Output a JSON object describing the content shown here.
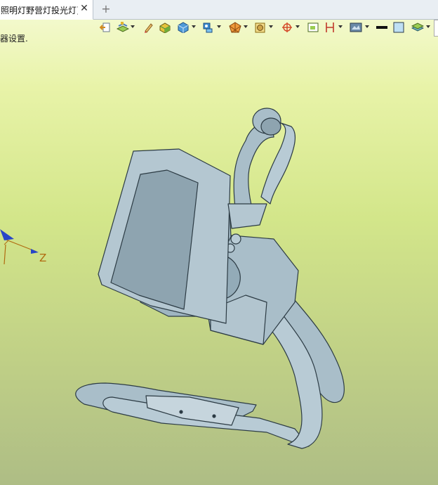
{
  "tab": {
    "title": "照明灯野营灯投光灯]",
    "close_glyph": "✕",
    "add_glyph": "+"
  },
  "hint": {
    "text": "器设置."
  },
  "triad": {
    "z_label": "Z"
  },
  "toolbar": {
    "items": [
      {
        "icon": "exit-sketch-icon",
        "dropdown": false
      },
      {
        "icon": "layers-icon",
        "dropdown": true
      },
      {
        "icon": "pencil-icon",
        "dropdown": false
      },
      {
        "icon": "shaded-box-icon",
        "dropdown": false
      },
      {
        "icon": "cube-view-icon",
        "dropdown": true
      },
      {
        "icon": "display-mode-icon",
        "dropdown": true
      },
      {
        "icon": "render-sphere-icon",
        "dropdown": true
      },
      {
        "icon": "section-view-icon",
        "dropdown": true
      },
      {
        "icon": "orient-triad-icon",
        "dropdown": true
      },
      {
        "icon": "fit-view-icon",
        "dropdown": false
      },
      {
        "icon": "dimension-icon",
        "dropdown": true
      },
      {
        "icon": "screen-capture-icon",
        "dropdown": true
      },
      {
        "icon": "line-style-icon",
        "dropdown": false
      },
      {
        "icon": "background-color-icon",
        "dropdown": false
      },
      {
        "icon": "layer-stack-icon",
        "dropdown": true
      }
    ],
    "colors": {
      "sketch": "#d48a1e",
      "shaded": "#6fae3a",
      "cube": "#2f7fc0",
      "sphere": "#e0731a",
      "triad": "#d44a2a",
      "dimension": "#c0392b"
    }
  },
  "scene": {
    "model_color": "#a9bec9",
    "edge_color": "#2c3b44",
    "background_top": "#f6fbd6",
    "background_bottom": "#aebd85"
  }
}
